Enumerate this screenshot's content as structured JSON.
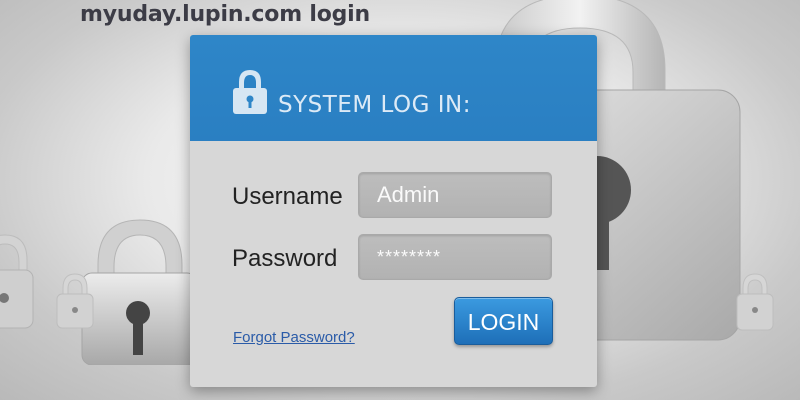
{
  "page": {
    "title": "myuday.lupin.com login"
  },
  "dialog": {
    "header_title": "SYSTEM LOG IN:",
    "header_icon": "padlock-icon",
    "username_label": "Username",
    "username_value": "Admin",
    "password_label": "Password",
    "password_value": "********",
    "forgot_link": "Forgot Password?",
    "login_button": "LOGIN"
  },
  "colors": {
    "header_blue": "#2e86c8",
    "button_blue": "#2a82cc",
    "panel_gray": "#d7d7d7",
    "link_blue": "#2a5ba8"
  },
  "background": {
    "decoration": "padlock-icon"
  }
}
